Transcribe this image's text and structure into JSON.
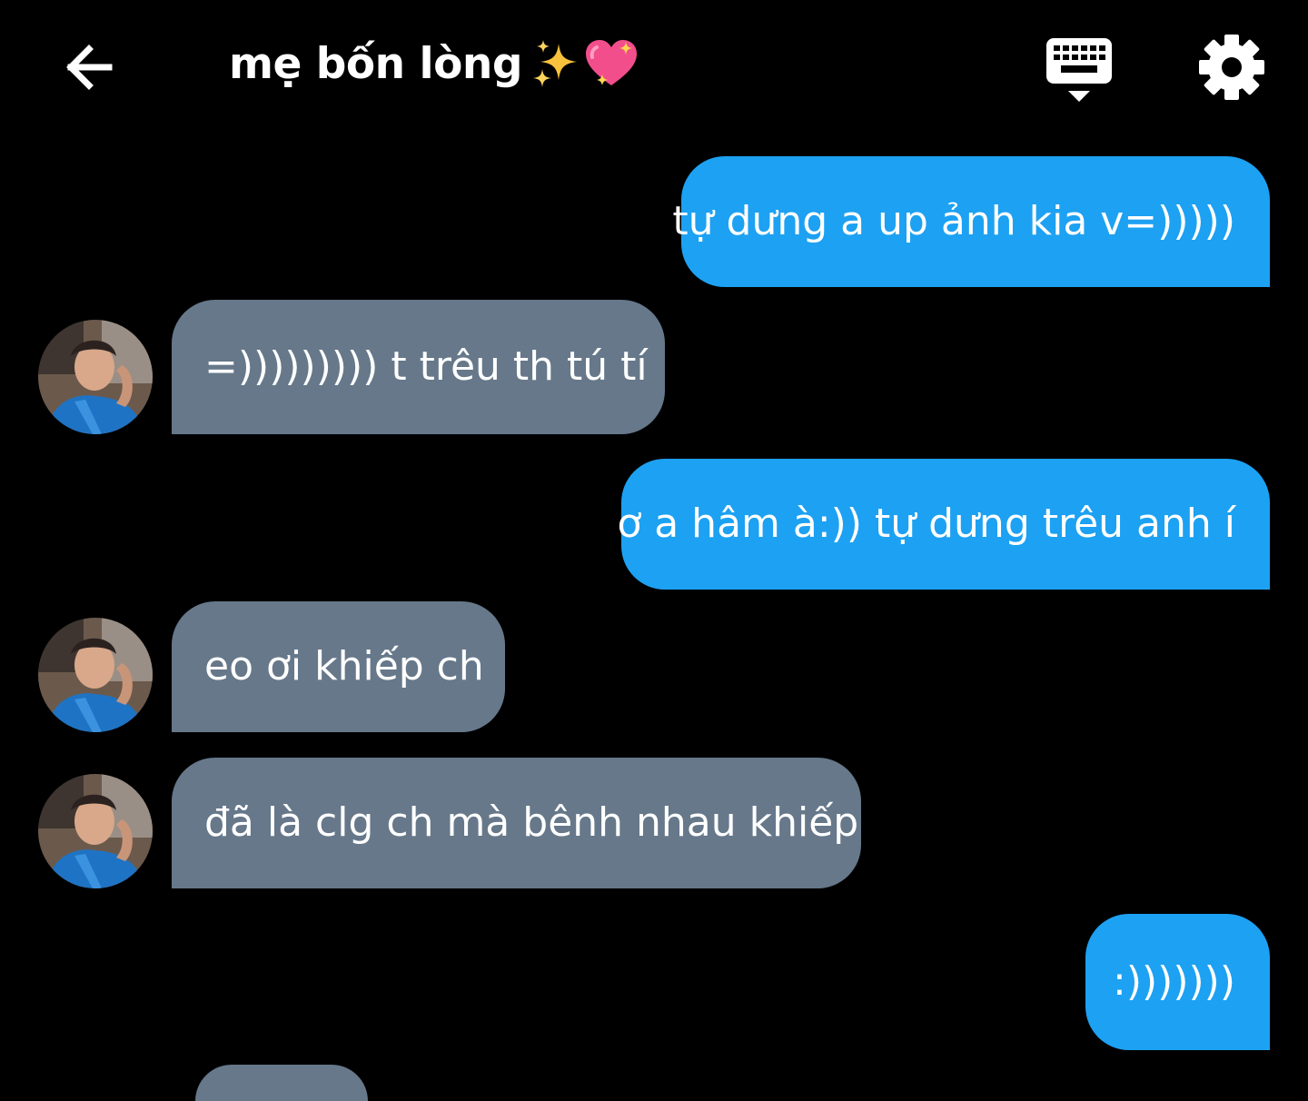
{
  "header": {
    "title": "mẹ bốn lòng",
    "title_emojis": [
      "sparkles",
      "sparkling-heart"
    ]
  },
  "icons": {
    "back": "arrow-left-icon",
    "keyboard": "keyboard-hide-icon",
    "settings": "gear-icon"
  },
  "colors": {
    "background": "#000000",
    "outgoing_bubble": "#1da1f2",
    "incoming_bubble": "#66788a",
    "text": "#ffffff"
  },
  "messages": [
    {
      "direction": "outgoing",
      "text": "tự dưng a up ảnh kia v=)))))"
    },
    {
      "direction": "incoming",
      "text": "=))))))))) t trêu th tú tí"
    },
    {
      "direction": "outgoing",
      "text": "ơ a hâm à:)) tự dưng trêu anh í"
    },
    {
      "direction": "incoming",
      "text": "eo ơi khiếp ch"
    },
    {
      "direction": "incoming",
      "text": "đã là clg ch mà bênh nhau khiếp"
    },
    {
      "direction": "outgoing",
      "text": ":)))))))"
    }
  ]
}
